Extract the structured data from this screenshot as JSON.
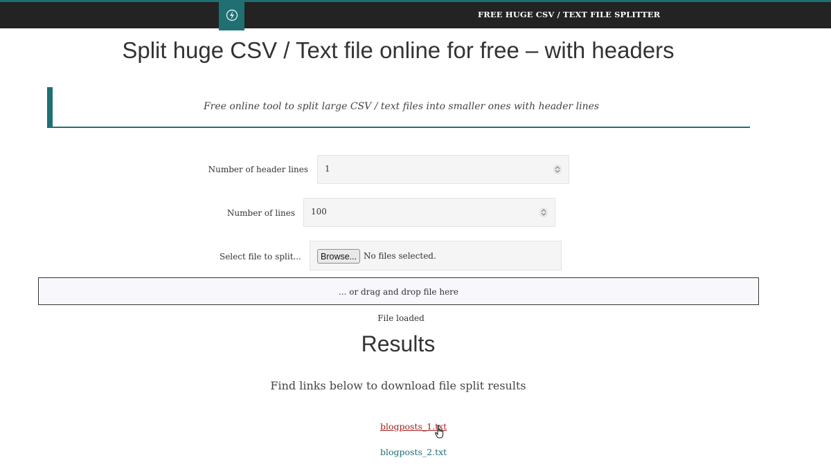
{
  "header": {
    "brand": "FREE HUGE CSV / TEXT FILE SPLITTER",
    "logo_icon": "lightning-logo-icon"
  },
  "page": {
    "title": "Split huge CSV / Text file online for free – with headers",
    "callout": "Free online tool to split large CSV / text files into smaller ones with header lines"
  },
  "form": {
    "header_lines": {
      "label": "Number of header lines",
      "value": "1"
    },
    "lines": {
      "label": "Number of lines",
      "value": "100"
    },
    "file": {
      "label": "Select file to split...",
      "browse_label": "Browse...",
      "status": "No files selected."
    },
    "dropzone": "... or drag and drop file here",
    "load_status": "File loaded"
  },
  "results": {
    "title": "Results",
    "subtitle": "Find links below to download file split results",
    "links": [
      "blogposts_1.txt",
      "blogposts_2.txt"
    ]
  },
  "colors": {
    "accent": "#1f6f73",
    "topbar": "#232323",
    "link_hover": "#a32020"
  }
}
